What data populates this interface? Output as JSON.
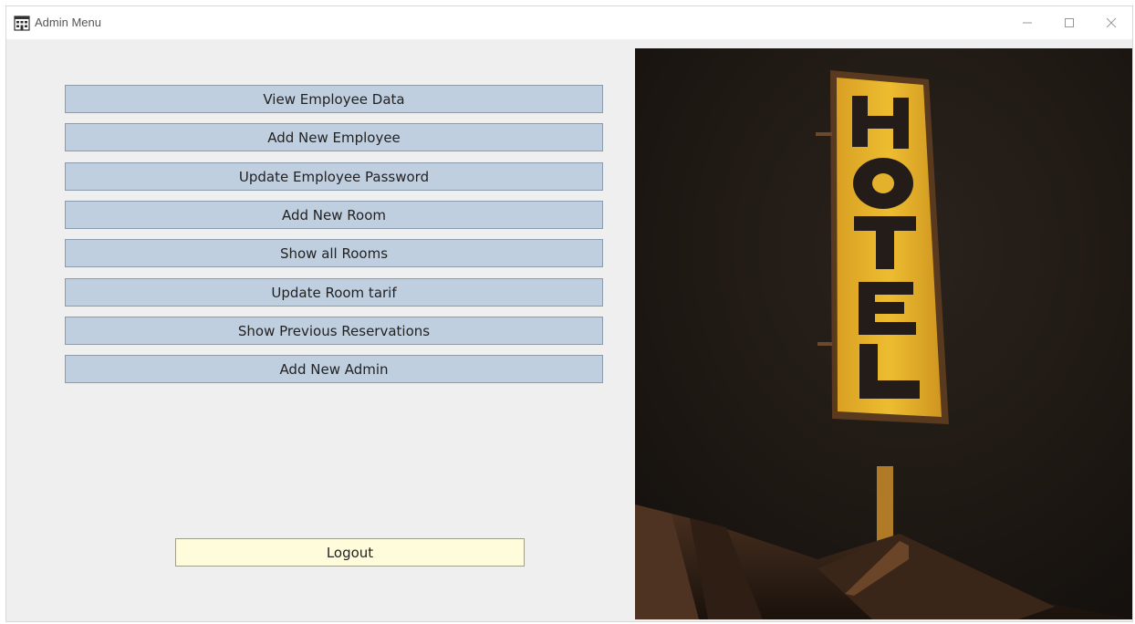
{
  "window": {
    "title": "Admin Menu",
    "controls": [
      "minimize",
      "maximize",
      "close"
    ]
  },
  "menu": {
    "buttons": [
      {
        "label": "View Employee Data"
      },
      {
        "label": "Add New Employee"
      },
      {
        "label": "Update Employee Password"
      },
      {
        "label": "Add New Room"
      },
      {
        "label": "Show all Rooms"
      },
      {
        "label": "Update Room tarif"
      },
      {
        "label": "Show Previous Reservations"
      },
      {
        "label": "Add New Admin"
      }
    ],
    "logout_label": "Logout"
  },
  "image": {
    "sign_letters": [
      "H",
      "O",
      "T",
      "E",
      "L"
    ]
  },
  "colors": {
    "menu_button_bg": "#c0cfdf",
    "logout_button_bg": "#fefcdb",
    "window_bg": "#efefef",
    "sign_yellow": "#e8b629"
  }
}
